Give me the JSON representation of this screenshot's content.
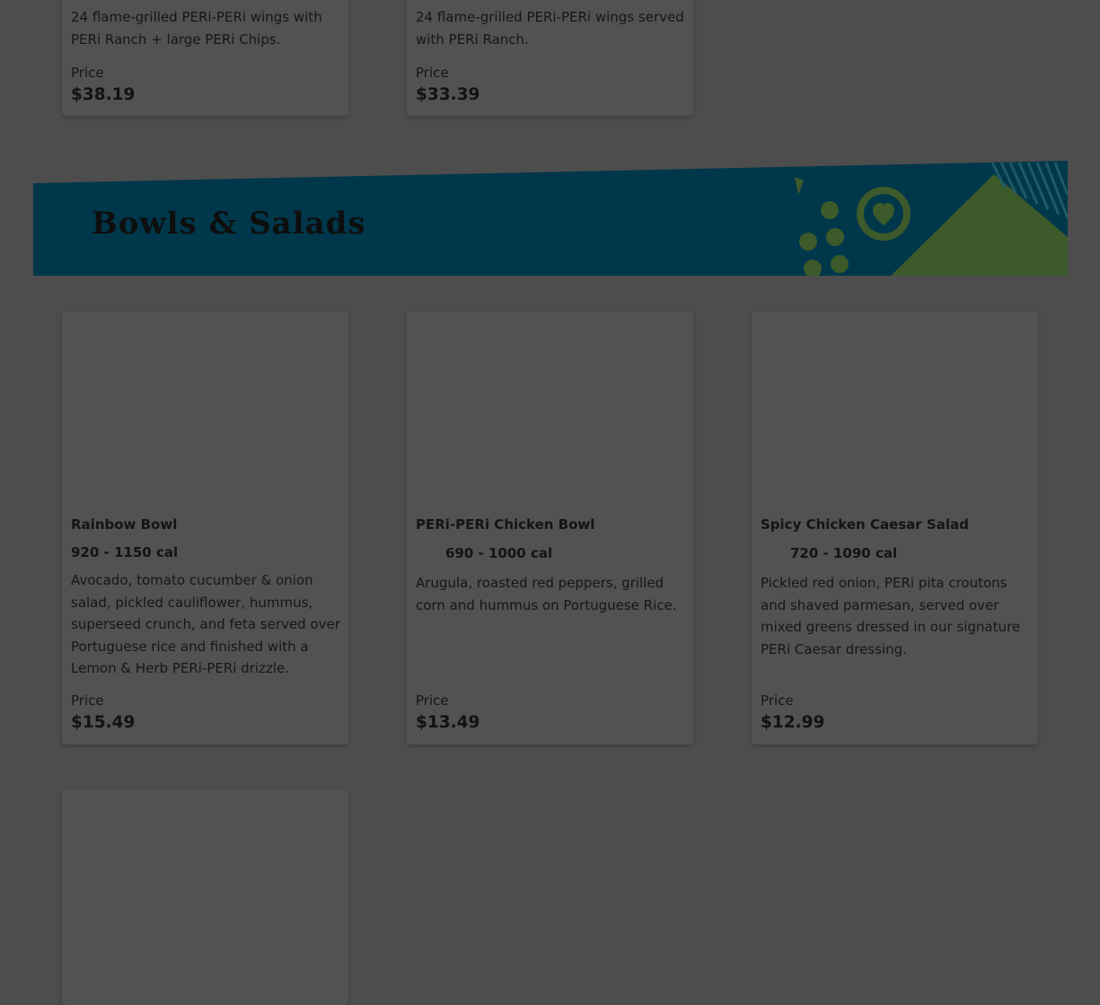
{
  "top_items": [
    {
      "description": "24 flame-grilled PERi-PERi wings with PERi Ranch + large PERi Chips.",
      "price_label": "Price",
      "price": "$38.19"
    },
    {
      "description": "24 flame-grilled PERi-PERi wings served with PERi Ranch.",
      "price_label": "Price",
      "price": "$33.39"
    }
  ],
  "section": {
    "title": "Bowls & Salads",
    "colors": {
      "banner_bg": "#00374a",
      "banner_accent_green": "#3d5a2a",
      "banner_accent_teal": "#1e5a63"
    }
  },
  "items": [
    {
      "name": "Rainbow Bowl",
      "calories": "920 - 1150 cal",
      "description": "Avocado, tomato cucumber & onion salad, pickled cauliflower, hummus, superseed crunch, and feta served over Portuguese rice and finished with a Lemon & Herb PERi-PERi drizzle.",
      "price_label": "Price",
      "price": "$15.49"
    },
    {
      "name": "PERi-PERi Chicken Bowl",
      "calories": "690 - 1000 cal",
      "description": "Arugula, roasted red peppers, grilled corn and hummus on Portuguese Rice.",
      "price_label": "Price",
      "price": "$13.49"
    },
    {
      "name": "Spicy Chicken Caesar Salad",
      "calories": "720 - 1090 cal",
      "description": "Pickled red onion, PERi pita croutons and shaved parmesan, served over mixed greens dressed in our signature PERi Caesar dressing.",
      "price_label": "Price",
      "price": "$12.99"
    }
  ],
  "page": {
    "overlay_color": "#4d4d4d",
    "card_color": "#525252"
  }
}
